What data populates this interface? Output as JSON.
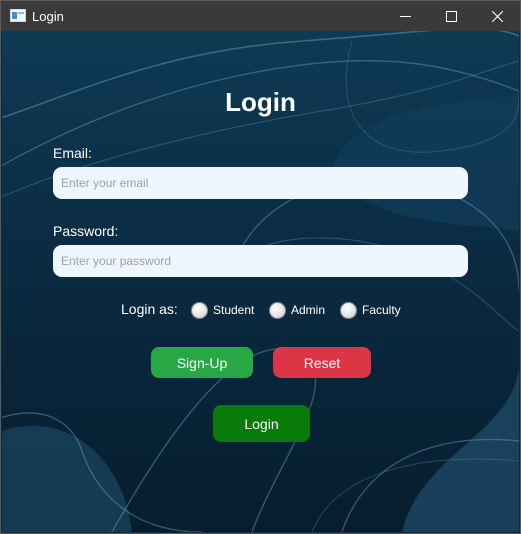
{
  "window": {
    "title": "Login",
    "controls": {
      "minimize": "minimize-icon",
      "maximize": "maximize-icon",
      "close": "close-icon"
    }
  },
  "form": {
    "heading": "Login",
    "email": {
      "label": "Email:",
      "placeholder": "Enter your email",
      "value": ""
    },
    "password": {
      "label": "Password:",
      "placeholder": "Enter your password",
      "value": ""
    },
    "role": {
      "label": "Login as:",
      "options": [
        "Student",
        "Admin",
        "Faculty"
      ],
      "selected": null
    },
    "buttons": {
      "signup": "Sign-Up",
      "reset": "Reset",
      "login": "Login"
    }
  },
  "colors": {
    "background": "#0a2b42",
    "signup": "#28a745",
    "reset": "#dc3545",
    "login": "#0a7a0a",
    "field": "#eef6ff"
  }
}
